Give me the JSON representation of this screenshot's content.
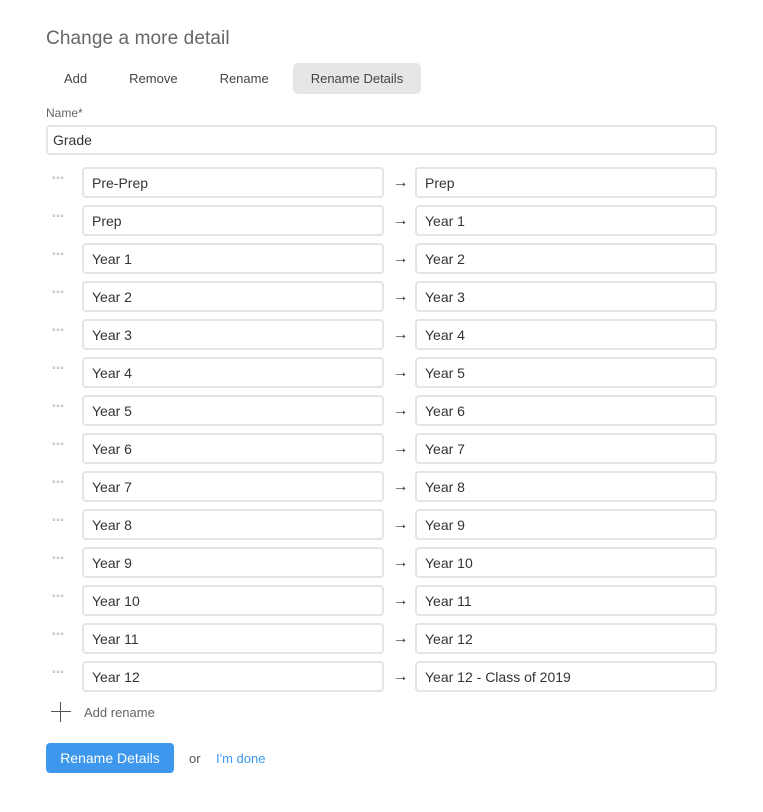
{
  "title": "Change a more detail",
  "tabs": [
    {
      "label": "Add",
      "active": false
    },
    {
      "label": "Remove",
      "active": false
    },
    {
      "label": "Rename",
      "active": false
    },
    {
      "label": "Rename Details",
      "active": true
    }
  ],
  "name_field": {
    "label": "Name*",
    "value": "Grade"
  },
  "arrow_glyph": "→",
  "drag_glyph": "°°°",
  "renames": [
    {
      "from": "Pre-Prep",
      "to": "Prep"
    },
    {
      "from": "Prep",
      "to": "Year 1"
    },
    {
      "from": "Year 1",
      "to": "Year 2"
    },
    {
      "from": "Year 2",
      "to": "Year 3"
    },
    {
      "from": "Year 3",
      "to": "Year 4"
    },
    {
      "from": "Year 4",
      "to": "Year 5"
    },
    {
      "from": "Year 5",
      "to": "Year 6"
    },
    {
      "from": "Year 6",
      "to": "Year 7"
    },
    {
      "from": "Year 7",
      "to": "Year 8"
    },
    {
      "from": "Year 8",
      "to": "Year 9"
    },
    {
      "from": "Year 9",
      "to": "Year 10"
    },
    {
      "from": "Year 10",
      "to": "Year 11"
    },
    {
      "from": "Year 11",
      "to": "Year 12"
    },
    {
      "from": "Year 12",
      "to": "Year 12 - Class of 2019"
    }
  ],
  "add_rename_label": "Add rename",
  "submit_label": "Rename Details",
  "or_text": "or",
  "done_label": "I'm done",
  "colors": {
    "accent": "#3d97ec",
    "active_tab": "#e6e6e6"
  }
}
